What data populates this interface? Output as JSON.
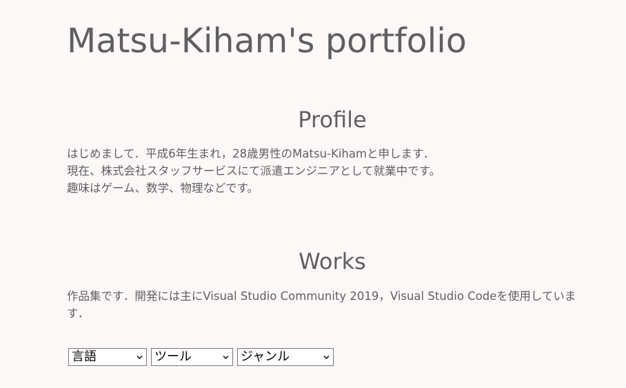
{
  "header": {
    "title": "Matsu-Kiham's portfolio"
  },
  "profile": {
    "heading": "Profile",
    "lines": [
      "はじめまして．平成6年生まれ，28歳男性のMatsu-Kihamと申します．",
      "現在、株式会社スタッフサービスにて派遣エンジニアとして就業中です。",
      "趣味はゲーム、数学、物理などです。"
    ]
  },
  "works": {
    "heading": "Works",
    "description": "作品集です．開発には主にVisual Studio Community 2019，Visual Studio Codeを使用しています．"
  },
  "filters": {
    "language": {
      "selected": "言語",
      "icon": "chevron-down-icon"
    },
    "tool": {
      "selected": "ツール",
      "icon": "chevron-down-icon"
    },
    "genre": {
      "selected": "ジャンル",
      "icon": "chevron-down-icon"
    }
  }
}
